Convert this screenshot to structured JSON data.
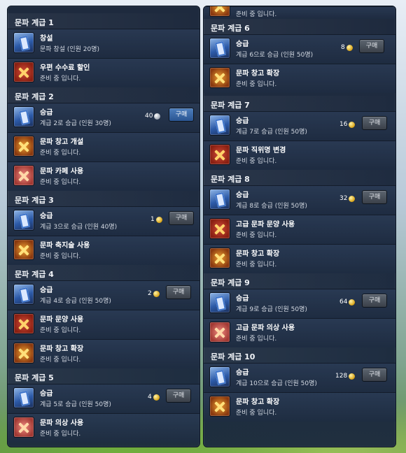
{
  "left_panel": {
    "sections": [
      {
        "title": "문파 계급 1"
      },
      {
        "title": "문파 계급 2"
      },
      {
        "title": "문파 계급 3"
      },
      {
        "title": "문파 계급 4"
      },
      {
        "title": "문파 계급 5"
      }
    ],
    "items": {
      "l1a": {
        "title": "창설",
        "desc": "문파 창설 (인원 20명)"
      },
      "l1b": {
        "title": "우편 수수료 할인",
        "desc": "준비 중 입니다."
      },
      "l2a": {
        "title": "승급",
        "desc": "계급 2로 승급 (인원 30명)",
        "cost": "40",
        "button": "구매"
      },
      "l2b": {
        "title": "문파 창고 개설",
        "desc": "준비 중 입니다."
      },
      "l2c": {
        "title": "문파 카페 사용",
        "desc": "준비 중 입니다."
      },
      "l3a": {
        "title": "승급",
        "desc": "계급 3으로 승급 (인원 40명)",
        "cost": "1",
        "button": "구매"
      },
      "l3b": {
        "title": "문파 축지술 사용",
        "desc": "준비 중 입니다."
      },
      "l4a": {
        "title": "승급",
        "desc": "계급 4로 승급 (인원 50명)",
        "cost": "2",
        "button": "구매"
      },
      "l4b": {
        "title": "문파 문양 사용",
        "desc": "준비 중 입니다."
      },
      "l4c": {
        "title": "문파 창고 확장",
        "desc": "준비 중 입니다."
      },
      "l5a": {
        "title": "승급",
        "desc": "계급 5로 승급 (인원 50명)",
        "cost": "4",
        "button": "구매"
      },
      "l5b": {
        "title": "문파 의상 사용",
        "desc": "준비 중 입니다."
      }
    }
  },
  "right_panel": {
    "top_partial_desc": "준비 중 입니다.",
    "sections": [
      {
        "title": "문파 계급 6"
      },
      {
        "title": "문파 계급 7"
      },
      {
        "title": "문파 계급 8"
      },
      {
        "title": "문파 계급 9"
      },
      {
        "title": "문파 계급 10"
      }
    ],
    "items": {
      "r6a": {
        "title": "승급",
        "desc": "계급 6으로 승급 (인원 50명)",
        "cost": "8",
        "button": "구매"
      },
      "r6b": {
        "title": "문파 창고 확장",
        "desc": "준비 중 입니다."
      },
      "r7a": {
        "title": "승급",
        "desc": "계급 7로 승급 (인원 50명)",
        "cost": "16",
        "button": "구매"
      },
      "r7b": {
        "title": "문파 직위명 변경",
        "desc": "준비 중 입니다."
      },
      "r8a": {
        "title": "승급",
        "desc": "계급 8로 승급 (인원 50명)",
        "cost": "32",
        "button": "구매"
      },
      "r8b": {
        "title": "고급 문파 문양 사용",
        "desc": "준비 중 입니다."
      },
      "r8c": {
        "title": "문파 창고 확장",
        "desc": "준비 중 입니다."
      },
      "r9a": {
        "title": "승급",
        "desc": "계급 9로 승급 (인원 50명)",
        "cost": "64",
        "button": "구매"
      },
      "r9b": {
        "title": "고급 문파 의상 사용",
        "desc": "준비 중 입니다."
      },
      "r10a": {
        "title": "승급",
        "desc": "계급 10으로 승급 (인원 50명)",
        "cost": "128",
        "button": "구매"
      },
      "r10b": {
        "title": "문파 창고 확장",
        "desc": "준비 중 입니다."
      }
    }
  },
  "colors": {
    "panel": "#1a2a40",
    "button_active": "#2a5592",
    "coin_gold": "#d9a214"
  }
}
